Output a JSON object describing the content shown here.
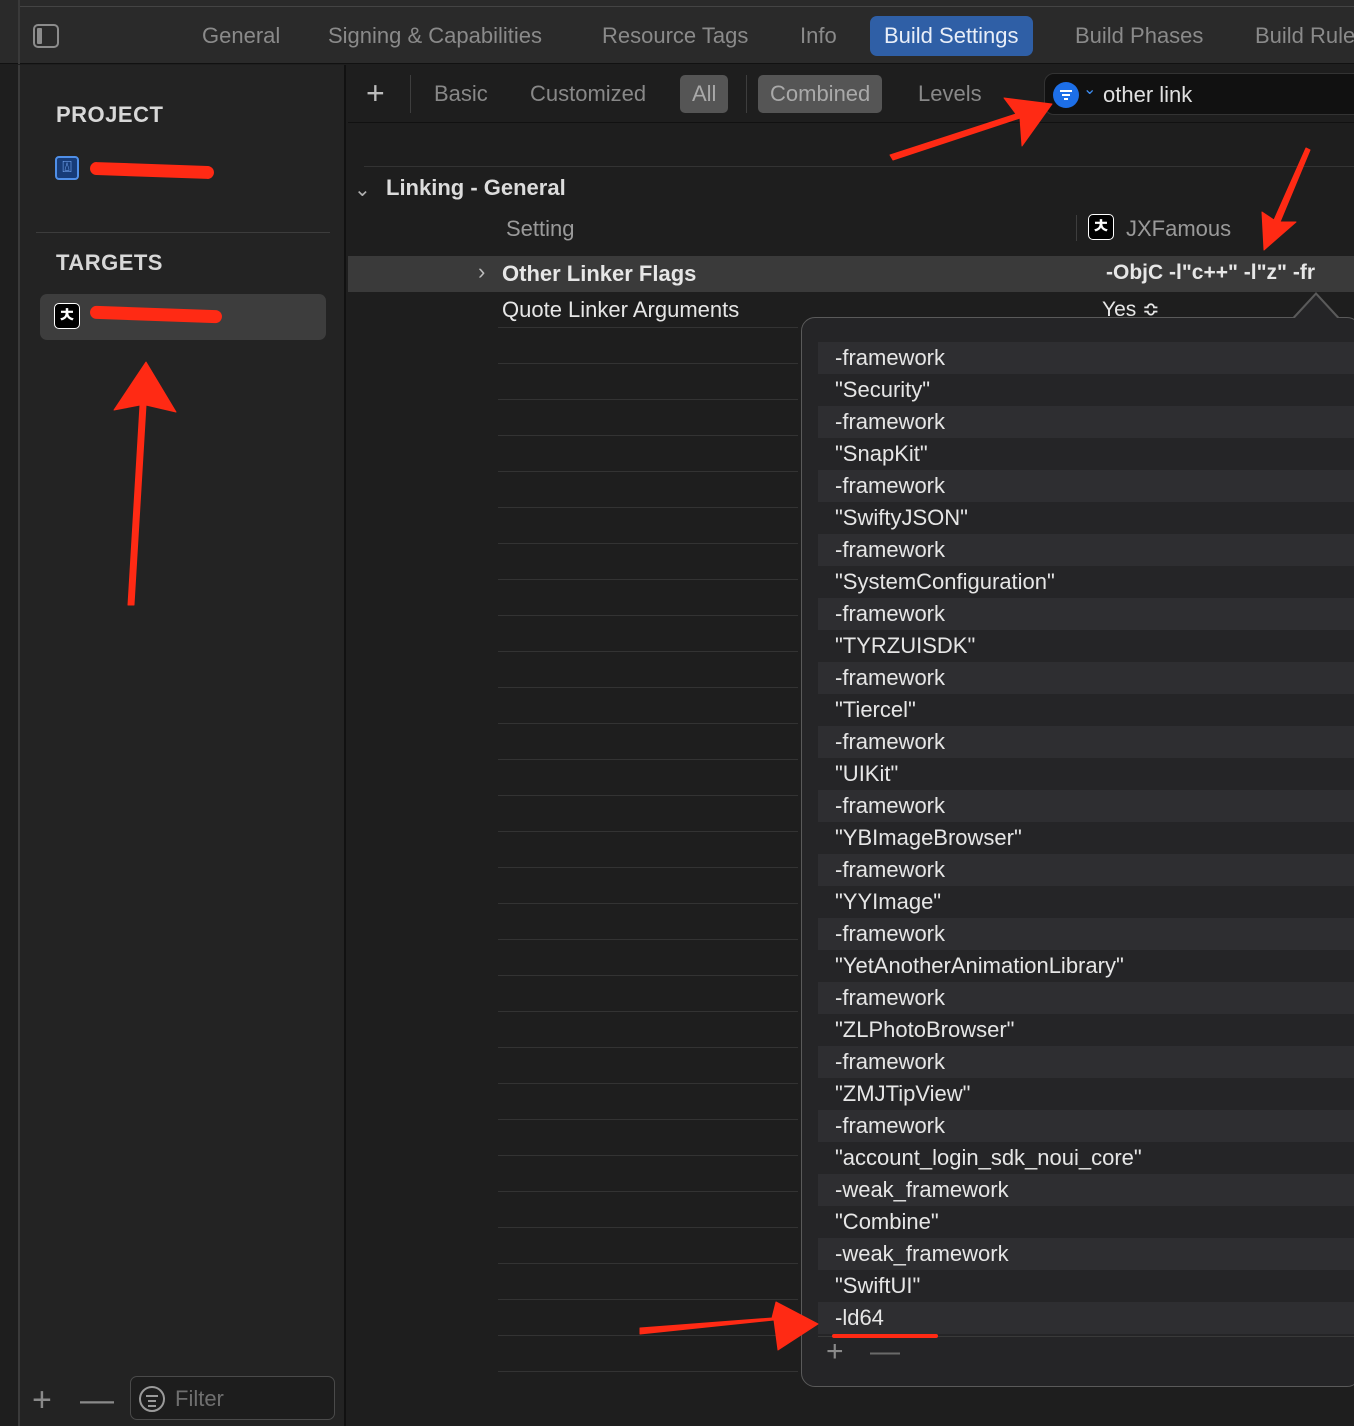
{
  "tabs": [
    "General",
    "Signing & Capabilities",
    "Resource Tags",
    "Info",
    "Build Settings",
    "Build Phases",
    "Build Rules"
  ],
  "active_tab": "Build Settings",
  "navigator": {
    "project_header": "PROJECT",
    "targets_header": "TARGETS",
    "filter_placeholder": "Filter"
  },
  "toolbar": {
    "add_label": "+",
    "segments": [
      "Basic",
      "Customized",
      "All",
      "Combined",
      "Levels"
    ],
    "search_value": "other link"
  },
  "settings": {
    "group_title": "Linking - General",
    "column_setting": "Setting",
    "column_target": "JXFamous",
    "rows": [
      {
        "label": "Other Linker Flags",
        "value": "-ObjC -l\"c++\" -l\"z\" -fr"
      },
      {
        "label": "Quote Linker Arguments",
        "value": "Yes ≎"
      }
    ]
  },
  "popover": {
    "items": [
      "-framework",
      "\"Security\"",
      "-framework",
      "\"SnapKit\"",
      "-framework",
      "\"SwiftyJSON\"",
      "-framework",
      "\"SystemConfiguration\"",
      "-framework",
      "\"TYRZUISDK\"",
      "-framework",
      "\"Tiercel\"",
      "-framework",
      "\"UIKit\"",
      "-framework",
      "\"YBImageBrowser\"",
      "-framework",
      "\"YYImage\"",
      "-framework",
      "\"YetAnotherAnimationLibrary\"",
      "-framework",
      "\"ZLPhotoBrowser\"",
      "-framework",
      "\"ZMJTipView\"",
      "-framework",
      "\"account_login_sdk_noui_core\"",
      "-weak_framework",
      "\"Combine\"",
      "-weak_framework",
      "\"SwiftUI\"",
      "-ld64"
    ],
    "add_label": "+",
    "remove_label": "—"
  },
  "colors": {
    "accent": "#2f5fa6",
    "annotation_red": "#ff2a14",
    "filter_blue": "#1d6fe8"
  }
}
